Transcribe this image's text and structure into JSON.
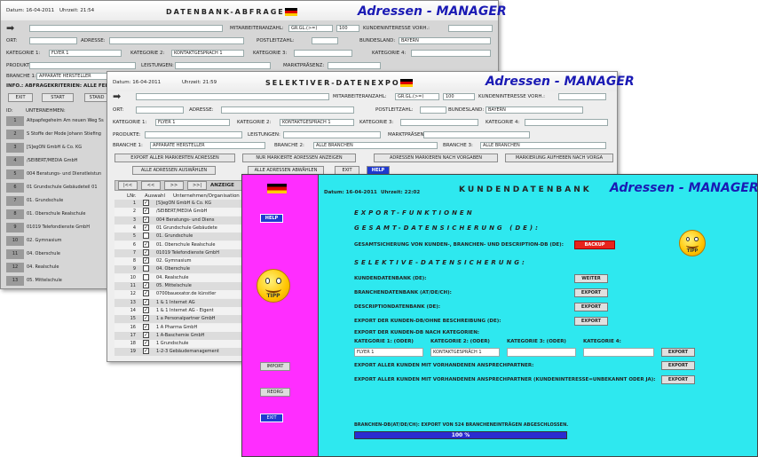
{
  "w1": {
    "datum": "Datum: 16-04-2011",
    "uhrzeit": "Uhrzeit: 21:54",
    "title": "DATENBANK-ABFRAGEN",
    "brand": "Adressen - MANAGER",
    "arrow": "➡",
    "ort": "ORT:",
    "adresse": "ADRESSE:",
    "plz": "POSTLEITZAHL:",
    "bundesland": "BUNDESLAND:",
    "bundesland_val": "BAYERN",
    "mitarbeiter": "MITARBEITERANZAHL:",
    "mit_op": "GR.GL.(>=)",
    "mit_val": "100",
    "kundeninteresse": "KUNDENINTERESSE VORH.:",
    "kat1": "KATEGORIE 1:",
    "kat1_val": "FLYER 1",
    "kat2": "KATEGORIE 2:",
    "kat2_val": "KONTAKTGESPRÄCH 1",
    "kat3": "KATEGORIE 3:",
    "kat4": "KATEGORIE 4:",
    "produkte": "PRODUKTE:",
    "leistungen": "LEISTUNGEN:",
    "marktpraesenz": "MARKTPRÄSENZ:",
    "branche1": "BRANCHE 1:",
    "branche1_val": "APPARATE HERSTELLER",
    "info": "INFO.: ABFRAGEKRITERIEN: ALLE FEL",
    "exit": "EXIT",
    "start": "START",
    "stand": "STAND",
    "id": "ID:",
    "unternehmen": "UNTERNEHMEN:",
    "rows": [
      {
        "n": "1",
        "t": "Altpapfegeheim Am neuen Weg 5s"
      },
      {
        "n": "2",
        "t": "S Stoffe der Mode Johann Stiefing"
      },
      {
        "n": "3",
        "t": "[S]egON GmbH & Co. KG"
      },
      {
        "n": "4",
        "t": "/SEIBERT/MEDIA GmbH"
      },
      {
        "n": "5",
        "t": "004 Beratungs- und Dienstleistun"
      },
      {
        "n": "6",
        "t": "01 Grundschule Gebäudeteil 01"
      },
      {
        "n": "7",
        "t": "01. Grundschule"
      },
      {
        "n": "8",
        "t": "01. Oberschule Realschule"
      },
      {
        "n": "9",
        "t": "01019 Telefondienste GmbH"
      },
      {
        "n": "10",
        "t": "02. Gymnasium"
      },
      {
        "n": "11",
        "t": "04. Oberschule"
      },
      {
        "n": "12",
        "t": "04. Realschule"
      },
      {
        "n": "13",
        "t": "05. Mittelschule"
      }
    ]
  },
  "w2": {
    "datum": "Datum: 16-04-2011",
    "uhrzeit": "Uhrzeit: 21:59",
    "title": "SELEKTIVER-DATENEXPORT",
    "brand": "Adressen - MANAGER",
    "arrow": "➡",
    "ort": "ORT:",
    "adresse": "ADRESSE:",
    "plz": "POSTLEITZAHL:",
    "bundesland": "BUNDESLAND:",
    "bundesland_val": "BAYERN",
    "mitarbeiter": "MITARBEITERANZAHL:",
    "mit_op": "GR.GL.(>=)",
    "mit_val": "100",
    "kundeninteresse": "KUNDENINTERESSE VORH.:",
    "kat1": "KATEGORIE 1:",
    "kat1_val": "FLYER 1",
    "kat2": "KATEGORIE 2:",
    "kat2_val": "KONTAKTGESPRÄCH 1",
    "kat3": "KATEGORIE 3:",
    "kat4": "KATEGORIE 4:",
    "produkte": "PRODUKTE:",
    "leistungen": "LEISTUNGEN:",
    "marktpraesenz": "MARKTPRÄSENZ:",
    "branche1": "BRANCHE 1:",
    "branche1_val": "APPARATE HERSTELLER",
    "branche2": "BRANCHE 2:",
    "branche2_val": "ALLE BRANCHEN",
    "branche3": "BRANCHE 3:",
    "branche3_val": "ALLE BRANCHEN",
    "b_export_markiert": "EXPORT ALLER MARKIERTEN ADRESSEN",
    "b_nur_markierte": "NUR MARKIERTE ADRESSEN ANZEIGEN",
    "b_adressen_markieren": "ADRESSEN MARKIEREN NACH VORGABEN",
    "b_markierung_aufheben": "MARKIERUNG AUFHEBEN NACH VORGA",
    "b_alle_auswaehlen": "ALLE ADRESSEN AUSWÄHLEN",
    "b_alle_abwaehlen": "ALLE ADRESSEN ABWÄHLEN",
    "exit": "EXIT",
    "help": "HELP",
    "nav": [
      "|<<",
      "<<",
      ">>",
      ">>|"
    ],
    "anzeige": "ANZEIGE",
    "lnr": "LNr.",
    "auswahl": "Auswahl",
    "unternehmen_org": "Unternehmen/Organisation",
    "rows": [
      {
        "n": "1",
        "t": "[S]egON GmbH & Co. KG",
        "c": true
      },
      {
        "n": "2",
        "t": "/SEIBERT/MEDIA GmbH",
        "c": true
      },
      {
        "n": "3",
        "t": "004 Beratungs- und Diens",
        "c": true
      },
      {
        "n": "4",
        "t": "01 Grundschule Gebäudete",
        "c": true
      },
      {
        "n": "5",
        "t": "01. Grundschule",
        "c": false
      },
      {
        "n": "6",
        "t": "01. Oberschule Realschule",
        "c": true
      },
      {
        "n": "7",
        "t": "01019 Telefondienste GmbH",
        "c": true
      },
      {
        "n": "8",
        "t": "02. Gymnasium",
        "c": true
      },
      {
        "n": "9",
        "t": "04. Oberschule",
        "c": false
      },
      {
        "n": "10",
        "t": "04. Realschule",
        "c": false
      },
      {
        "n": "11",
        "t": "05. Mittelschule",
        "c": true
      },
      {
        "n": "12",
        "t": "0700bauexator.de künstler",
        "c": true
      },
      {
        "n": "13",
        "t": "1 & 1 Internet AG",
        "c": true
      },
      {
        "n": "14",
        "t": "1 & 1 Internet AG - Eigent",
        "c": true
      },
      {
        "n": "15",
        "t": "1 a Personalpartner GmbH",
        "c": true
      },
      {
        "n": "16",
        "t": "1 A Pharma GmbH",
        "c": true
      },
      {
        "n": "17",
        "t": "1 A-Baschemie GmbH",
        "c": true
      },
      {
        "n": "18",
        "t": "1 Grundschule",
        "c": true
      },
      {
        "n": "19",
        "t": "1-2-3 Gebäudemanagement",
        "c": true
      }
    ]
  },
  "w3": {
    "datum": "Datum: 16-04-2011",
    "uhrzeit": "Uhrzeit: 22:02",
    "title": "KUNDENDATENBANK",
    "brand": "Adressen - MANAGER",
    "help": "HELP",
    "tipp": "TIPP",
    "import": "IMPORT",
    "reorg": "REORG",
    "exit": "EXIT",
    "export_funktionen": "EXPORT-FUNKTIONEN",
    "gesamt": "GESAMT-DATENSICHERUNG (DE):",
    "gesamt_label": "GESAMTSICHERUNG VON KUNDEN-, BRANCHEN- UND DESCRIPTION-DB (DE):",
    "backup": "BACKUP",
    "selektiv": "SELEKTIVE-DATENSICHERUNG:",
    "kundendb": "KUNDENDATENBANK (DE):",
    "weiter": "WEITER",
    "branchendb": "BRANCHENDATENBANK (AT/DE/CH):",
    "export": "EXPORT",
    "descdb": "DESCRIPTIONDATENBANK (DE):",
    "export_ohne": "EXPORT DER KUNDEN-DB/OHNE BESCHREIBUNG (DE):",
    "export_kat": "EXPORT DER KUNDEN-DB NACH KATEGORIEN:",
    "kat1": "KATEGORIE 1: (ODER)",
    "kat2": "KATEGORIE 2: (ODER)",
    "kat3": "KATEGORIE 3: (ODER)",
    "kat4": "KATEGORIE 4:",
    "kat1_val": "FLYER 1",
    "kat2_val": "KONTAKTGESPRÄCH 1",
    "export_alle_ansprech": "EXPORT ALLER KUNDEN MIT VORHANDENEN ANSPRECHPARTNER:",
    "export_alle_interesse": "EXPORT ALLER KUNDEN MIT VORHANDENEN ANSPRECHPARTNER (KUNDENINTERESSE=UNBEKANNT ODER JA):",
    "status": "BRANCHEN-DB(AT/DE/CH): EXPORT VON 524 BRANCHENEINTRÄGEN ABGESCHLOSSEN.",
    "progress_label": "100 %",
    "progress": 1.0
  },
  "colors": {
    "w1_bg": "#d9d9d9",
    "w3_left": "#ff2dff",
    "w3_main": "#2ee8ef",
    "brand_blue": "#1a1ab4",
    "progress": "#2b2bd0"
  }
}
